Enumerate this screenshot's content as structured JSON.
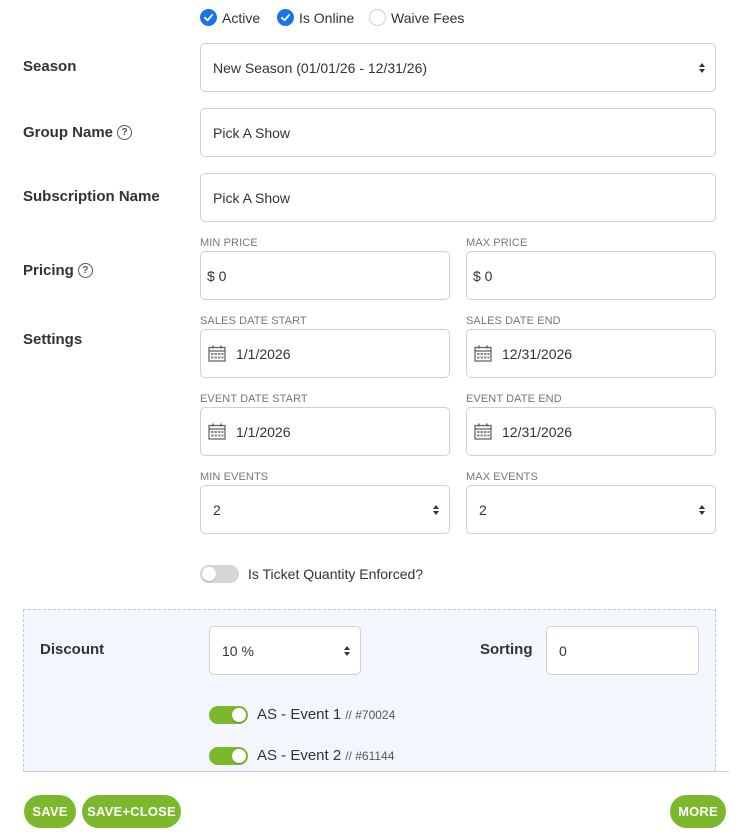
{
  "status": {
    "active": {
      "label": "Active",
      "checked": true
    },
    "online": {
      "label": "Is Online",
      "checked": true
    },
    "waive": {
      "label": "Waive Fees",
      "checked": false
    }
  },
  "season": {
    "label": "Season",
    "value": "New Season (01/01/26 - 12/31/26)"
  },
  "group": {
    "label": "Group Name",
    "value": "Pick A Show"
  },
  "subscription": {
    "label": "Subscription Name",
    "value": "Pick A Show"
  },
  "pricing": {
    "label": "Pricing",
    "min_label": "MIN PRICE",
    "min_value": "$ 0",
    "max_label": "MAX PRICE",
    "max_value": "$ 0"
  },
  "settings": {
    "label": "Settings",
    "sales_start_label": "SALES DATE START",
    "sales_start_value": "1/1/2026",
    "sales_end_label": "SALES DATE END",
    "sales_end_value": "12/31/2026",
    "event_start_label": "EVENT DATE START",
    "event_start_value": "1/1/2026",
    "event_end_label": "EVENT DATE END",
    "event_end_value": "12/31/2026",
    "min_events_label": "MIN EVENTS",
    "min_events_value": "2",
    "max_events_label": "MAX EVENTS",
    "max_events_value": "2"
  },
  "ticket_quantity": {
    "label": "Is Ticket Quantity Enforced?",
    "enabled": false
  },
  "discount": {
    "label": "Discount",
    "value": "10 %",
    "sorting_label": "Sorting",
    "sorting_value": "0"
  },
  "events": [
    {
      "name": "AS - Event 1",
      "ref": "// #70024",
      "enabled": true
    },
    {
      "name": "AS - Event 2",
      "ref": "// #61144",
      "enabled": true
    }
  ],
  "buttons": {
    "save": "SAVE",
    "save_close": "SAVE+CLOSE",
    "more": "MORE"
  },
  "colors": {
    "accent_green": "#7bb82c",
    "check_blue": "#1a73e8",
    "panel_bg": "#f3f7fd"
  }
}
